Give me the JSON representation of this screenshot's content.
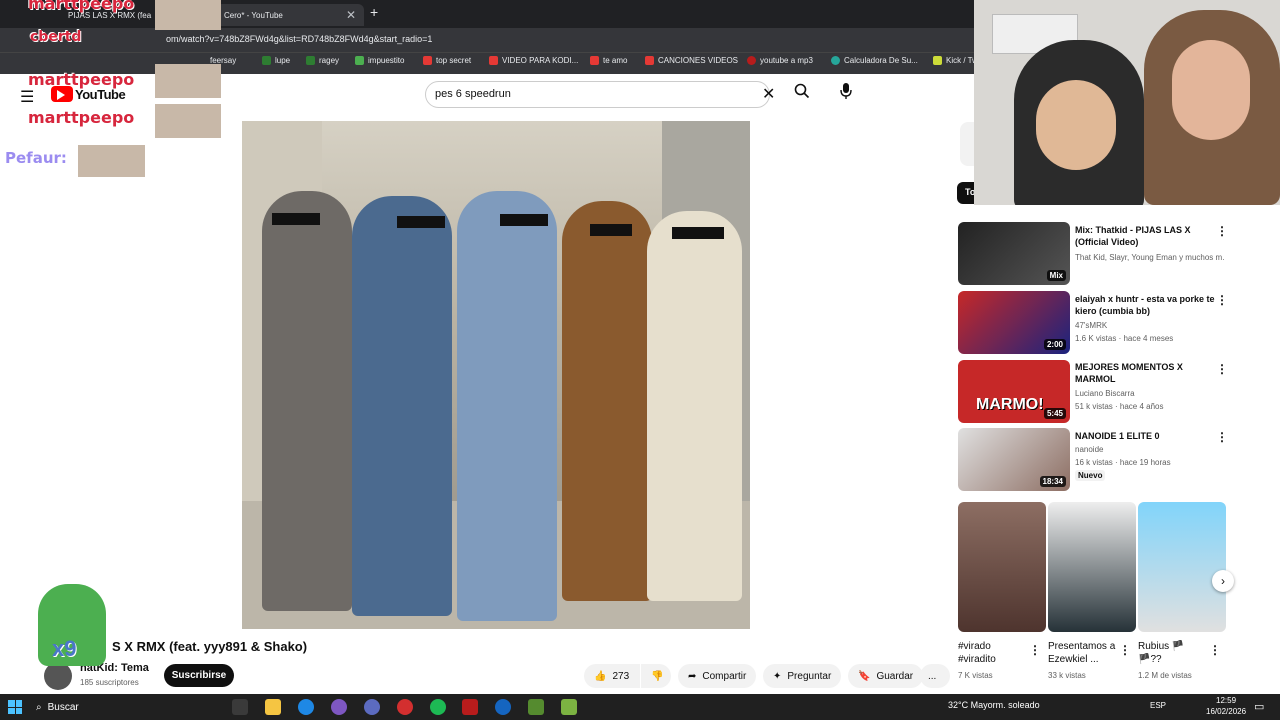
{
  "browser": {
    "tabs": [
      {
        "label": "PIJAS LAS X RMX (fea"
      },
      {
        "label": "Cero* - YouTube"
      }
    ],
    "new_tab": "+",
    "url": "om/watch?v=748bZ8FWd4g&list=RD748bZ8FWd4g&start_radio=1",
    "bookmarks": [
      "feersay",
      "lupe",
      "ragey",
      "impuestito",
      "top secret",
      "VIDEO PARA KODI...",
      "te amo",
      "CANCIONES VIDEOS",
      "youtube a mp3",
      "Calculadora De Su...",
      "Kick / Tw"
    ]
  },
  "youtube": {
    "logo": "YouTube",
    "search_value": "pes 6 speedrun",
    "video_title": "S X RMX (feat. yyy891 & Shako)",
    "channel": "hatKid: Tema",
    "subscribers": "185 suscriptores",
    "subscribe_label": "Suscribirse",
    "likes": "273",
    "share_label": "Compartir",
    "ask_label": "Preguntar",
    "save_label": "Guardar",
    "more_label": "..."
  },
  "sidebar": {
    "partial_chip": "To",
    "recommendations": [
      {
        "title": "Mix: Thatkid - PIJAS LAS X (Official Video)",
        "meta1": "That Kid, Slayr, Young Eman y muchos m...",
        "meta2": "",
        "duration": "Mix",
        "badge": ""
      },
      {
        "title": "elaiyah x huntr - esta va porke te kiero (cumbia bb)",
        "meta1": "47'sMRK",
        "meta2": "1.6 K vistas · hace 4 meses",
        "duration": "2:00",
        "badge": ""
      },
      {
        "title": "MEJORES MOMENTOS X MARMOL",
        "meta1": "Luciano Biscarra",
        "meta2": "51 k vistas · hace 4 años",
        "duration": "5:45",
        "badge": ""
      },
      {
        "title": "NANOIDE 1 ELITE 0",
        "meta1": "nanoide",
        "meta2": "16 k vistas · hace 19 horas",
        "duration": "18:34",
        "badge": "Nuevo"
      }
    ],
    "shorts": [
      {
        "title": "#virado #viradito",
        "views": "7 K vistas"
      },
      {
        "title": "Presentamos a Ezewkiel ...",
        "views": "33 k vistas"
      },
      {
        "title": "Rubius 🏴 🏴??",
        "views": "1.2 M de vistas"
      }
    ],
    "thumb2_caption": "MARMO!"
  },
  "overlays": {
    "name1": "marttpeepo",
    "name2": "marttpeepo",
    "name3": "Pefaur:",
    "name4": "cbertd",
    "pepe_text": "x9"
  },
  "taskbar": {
    "search_placeholder": "Buscar",
    "weather": "32°C  Mayorm. soleado",
    "lang": "ESP",
    "time": "12:59",
    "date": "16/02/2026"
  },
  "colors": {
    "accent": "#ff0000",
    "text": "#0f0f0f",
    "meta": "#606060",
    "taskbar": "#202020"
  }
}
